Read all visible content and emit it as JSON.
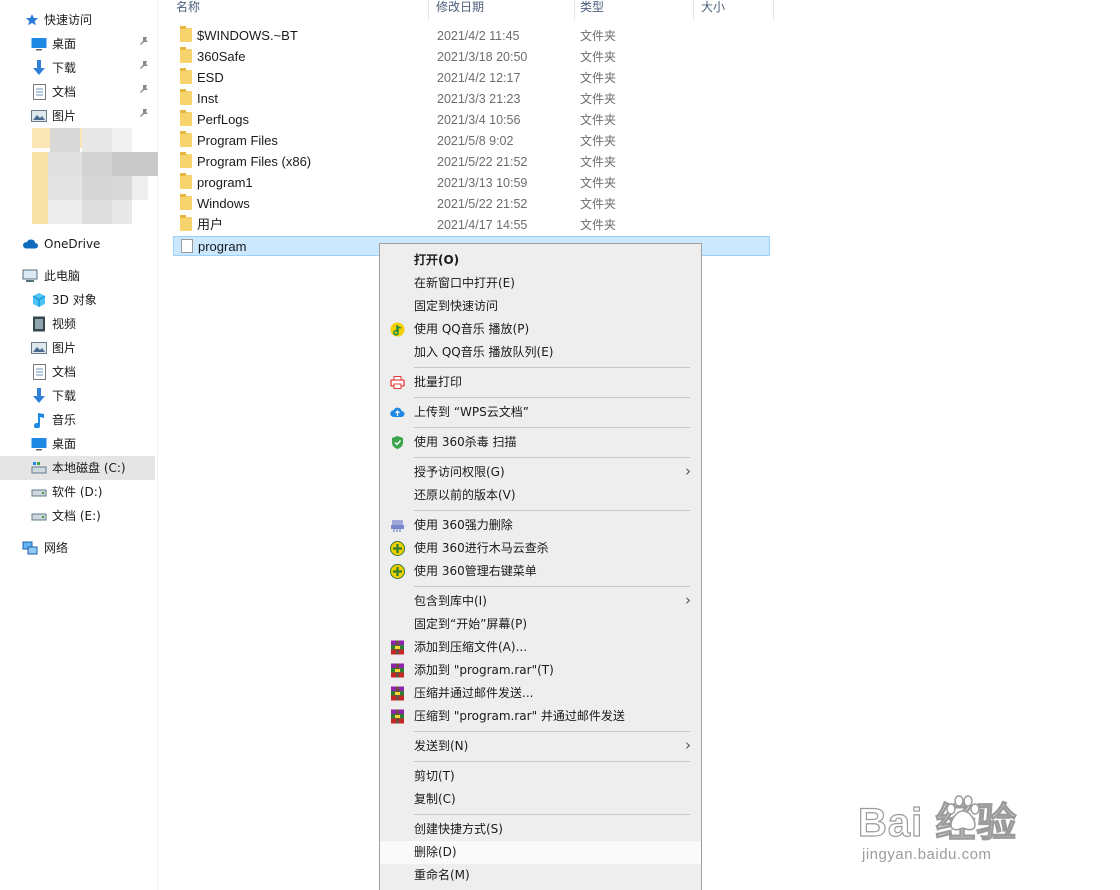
{
  "sidebar": {
    "quick_access": "快速访问",
    "quick_items": [
      {
        "label": "桌面",
        "icon": "desktop-icon"
      },
      {
        "label": "下载",
        "icon": "download-icon"
      },
      {
        "label": "文档",
        "icon": "document-icon"
      },
      {
        "label": "图片",
        "icon": "picture-icon"
      }
    ],
    "onedrive": "OneDrive",
    "this_pc": "此电脑",
    "pc_items": [
      {
        "label": "3D 对象",
        "icon": "3d-objects-icon"
      },
      {
        "label": "视频",
        "icon": "video-icon"
      },
      {
        "label": "图片",
        "icon": "picture-icon"
      },
      {
        "label": "文档",
        "icon": "document-icon"
      },
      {
        "label": "下载",
        "icon": "download-icon"
      },
      {
        "label": "音乐",
        "icon": "music-icon"
      },
      {
        "label": "桌面",
        "icon": "desktop-icon"
      },
      {
        "label": "本地磁盘 (C:)",
        "icon": "local-disk-icon",
        "selected": true
      },
      {
        "label": "软件 (D:)",
        "icon": "drive-icon"
      },
      {
        "label": "文档 (E:)",
        "icon": "drive-icon"
      }
    ],
    "network": "网络"
  },
  "columns": {
    "name": "名称",
    "date": "修改日期",
    "type": "类型",
    "size": "大小"
  },
  "files": [
    {
      "name": "$WINDOWS.~BT",
      "date": "2021/4/2 11:45",
      "type": "文件夹",
      "kind": "folder"
    },
    {
      "name": "360Safe",
      "date": "2021/3/18 20:50",
      "type": "文件夹",
      "kind": "folder"
    },
    {
      "name": "ESD",
      "date": "2021/4/2 12:17",
      "type": "文件夹",
      "kind": "folder"
    },
    {
      "name": "Inst",
      "date": "2021/3/3 21:23",
      "type": "文件夹",
      "kind": "folder"
    },
    {
      "name": "PerfLogs",
      "date": "2021/3/4 10:56",
      "type": "文件夹",
      "kind": "folder"
    },
    {
      "name": "Program Files",
      "date": "2021/5/8 9:02",
      "type": "文件夹",
      "kind": "folder"
    },
    {
      "name": "Program Files (x86)",
      "date": "2021/5/22 21:52",
      "type": "文件夹",
      "kind": "folder"
    },
    {
      "name": "program1",
      "date": "2021/3/13 10:59",
      "type": "文件夹",
      "kind": "folder"
    },
    {
      "name": "Windows",
      "date": "2021/5/22 21:52",
      "type": "文件夹",
      "kind": "folder"
    },
    {
      "name": "用户",
      "date": "2021/4/17 14:55",
      "type": "文件夹",
      "kind": "folder"
    },
    {
      "name": "program",
      "date": "",
      "type": "",
      "kind": "file",
      "selected": true
    }
  ],
  "context_menu": {
    "items": [
      {
        "label": "打开(O)",
        "bold": true
      },
      {
        "label": "在新窗口中打开(E)"
      },
      {
        "label": "固定到快速访问"
      },
      {
        "label": "使用 QQ音乐 播放(P)",
        "icon": "qq-music-icon"
      },
      {
        "label": "加入 QQ音乐 播放队列(E)"
      },
      {
        "sep": true
      },
      {
        "label": "批量打印",
        "icon": "printer-icon"
      },
      {
        "sep": true
      },
      {
        "label": "上传到 “WPS云文档”",
        "icon": "cloud-upload-icon"
      },
      {
        "sep": true
      },
      {
        "label": "使用 360杀毒 扫描",
        "icon": "shield-360-icon"
      },
      {
        "sep": true
      },
      {
        "label": "授予访问权限(G)",
        "submenu": true
      },
      {
        "label": "还原以前的版本(V)"
      },
      {
        "sep": true
      },
      {
        "label": "使用 360强力删除",
        "icon": "shredder-360-icon"
      },
      {
        "label": "使用 360进行木马云查杀",
        "icon": "scan-360-icon"
      },
      {
        "label": "使用 360管理右键菜单",
        "icon": "menu-360-icon"
      },
      {
        "sep": true
      },
      {
        "label": "包含到库中(I)",
        "submenu": true
      },
      {
        "label": "固定到“开始”屏幕(P)"
      },
      {
        "label": "添加到压缩文件(A)...",
        "icon": "winrar-icon"
      },
      {
        "label": "添加到 \"program.rar\"(T)",
        "icon": "winrar-icon"
      },
      {
        "label": "压缩并通过邮件发送...",
        "icon": "winrar-icon"
      },
      {
        "label": "压缩到 \"program.rar\" 并通过邮件发送",
        "icon": "winrar-icon"
      },
      {
        "sep": true
      },
      {
        "label": "发送到(N)",
        "submenu": true
      },
      {
        "sep": true
      },
      {
        "label": "剪切(T)"
      },
      {
        "label": "复制(C)"
      },
      {
        "sep": true
      },
      {
        "label": "创建快捷方式(S)"
      },
      {
        "label": "删除(D)",
        "highlighted": true
      },
      {
        "label": "重命名(M)"
      }
    ]
  },
  "watermark": {
    "brand": "Bai  经验",
    "site": "jingyan.baidu.com"
  }
}
